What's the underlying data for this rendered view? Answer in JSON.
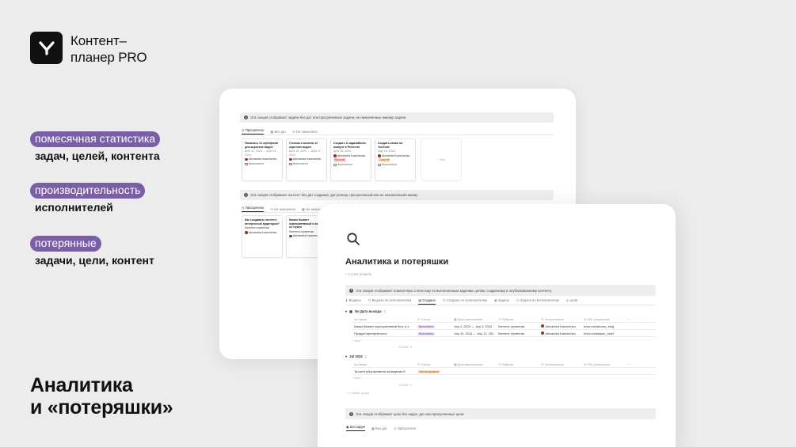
{
  "brand": {
    "line1": "Контент–",
    "line2": "планер PRO"
  },
  "features": [
    {
      "pill": "помесячная статистика",
      "sub": "задач, целей, контента"
    },
    {
      "pill": "производительность",
      "sub": "исполнителей"
    },
    {
      "pill": "потерянные",
      "sub": "задачи, цели, контент"
    }
  ],
  "headline": {
    "line1": "Аналитика",
    "line2": "и «потеряшки»"
  },
  "back_card": {
    "callout1": "Эта секция отображает задачи без дат или просроченные задачи, не назначенные никому задачи",
    "tabs1": [
      "Просрочено",
      "Без дат",
      "Не назначено"
    ],
    "cards": [
      {
        "title": "Написать 12 сценариев для коротких видео",
        "date": "April 11, 2024 → April 12, 2024",
        "user": "Alexandra Ivaschenko",
        "check": "Выполнено"
      },
      {
        "title": "Съемка и монтаж 12 коротких видео",
        "date": "April 15, 2024 → April 17, 2024",
        "user": "Alexandra Ivaschenko",
        "check": "Выполнено"
      },
      {
        "title": "Создать и задизайнить аккаунт в Pinterest",
        "date": "April 16, 2024",
        "user": "Alexandra Ivaschenko",
        "tag": "Высокий",
        "check": "Выполнено"
      },
      {
        "title": "Создать канал на YouTube",
        "date": "May 16, 2024",
        "user": "Alexandra Ivaschenko",
        "tag": "Средний",
        "check": "Выполнено"
      }
    ],
    "new_label": "+ New",
    "callout2": "Эта секция отображает контент без дат создания, дат релиза, просроченный или не назначенный никому",
    "tabs2": [
      "Просрочено",
      "Не назначено",
      "Не назначено"
    ],
    "cards2": [
      {
        "title": "Как создавать контент, интересный аудитории?",
        "user": "Контент-стратегия",
        "user2": "Alexandra Ivaschenko"
      },
      {
        "title": "Каким бывает корпоративный и зачем он нужен",
        "user": "Контент-стратегия",
        "user2": "Alexandra Ivaschenko"
      }
    ]
  },
  "front_card": {
    "title": "Аналитика и потеряшки",
    "add_property": "+ 1 more property",
    "callout": "Эта секция отображает помесячную статистику по выполненным задачам, целям, созданному и опубликованному контенту",
    "view_tabs": [
      "Выдача",
      "Выдача по исполнителям",
      "Создано",
      "Создано по исполнителям",
      "Задачи",
      "Задачи по исполнителям",
      "Цели"
    ],
    "group1": {
      "label": "No Дата выхода",
      "count": "2"
    },
    "headers": [
      "Name",
      "Статус",
      "Дата выполнения",
      "Рубрика",
      "Исполнитель",
      "URL результата"
    ],
    "rows1": [
      {
        "name": "Каким бывает корпоративный блог и з",
        "status": "Выполнено",
        "date": "July 2, 2024 → July 4, 2024",
        "rubric": "Контент-стратегия",
        "user": "Alexandra Ivaschenko",
        "url": "evos.media/corp_blog"
      },
      {
        "name": "Продуктоцентричность",
        "status": "Выполнено",
        "date": "July 10, 2024 → July 12, 202",
        "rubric": "Контент-стратегия",
        "user": "Alexandra Ivaschenko",
        "url": "evos.media/pdc_new7"
      }
    ],
    "new1": "+ New",
    "count1": "COUNT 2",
    "group2": {
      "label": "Jul 2024",
      "count": "1"
    },
    "rows2": [
      {
        "name": "Трогите рбку времени на ведение Е",
        "status": "Запланировано",
        "date": "",
        "rubric": "",
        "user": "",
        "url": ""
      }
    ],
    "new2": "+ New",
    "count2": "COUNT 1",
    "hidden_group": "+ 1 hidden group",
    "callout2": "Эта секция отображает цели без задач, дат или просроченные цели",
    "tabs2": [
      "Без задач",
      "Без дат",
      "Просрочено"
    ]
  }
}
